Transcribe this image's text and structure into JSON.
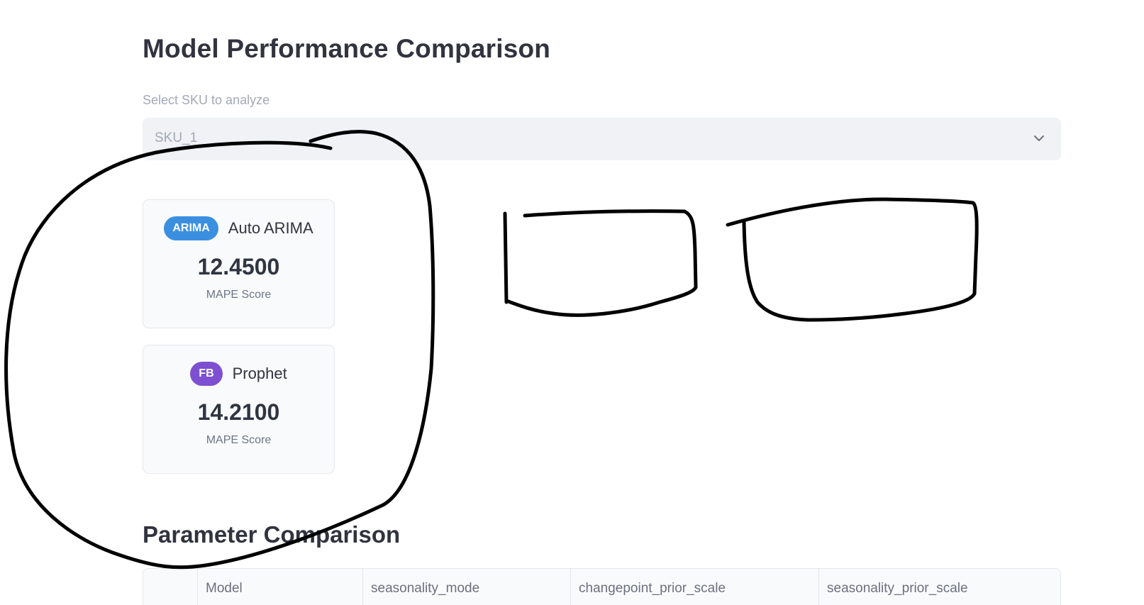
{
  "page": {
    "title": "Model Performance Comparison",
    "subtitle": "Parameter Comparison"
  },
  "sku_select": {
    "label": "Select SKU to analyze",
    "value": "SKU_1",
    "icon": "chevron-down-icon"
  },
  "models": [
    {
      "badge": "ARIMA",
      "name": "Auto ARIMA",
      "score": "12.4500",
      "score_label": "MAPE Score",
      "badge_color": "#3b8fe0"
    },
    {
      "badge": "FB",
      "name": "Prophet",
      "score": "14.2100",
      "score_label": "MAPE Score",
      "badge_color": "#7d4fd1"
    }
  ],
  "table": {
    "columns": [
      "",
      "Model",
      "seasonality_mode",
      "changepoint_prior_scale",
      "seasonality_prior_scale"
    ]
  }
}
